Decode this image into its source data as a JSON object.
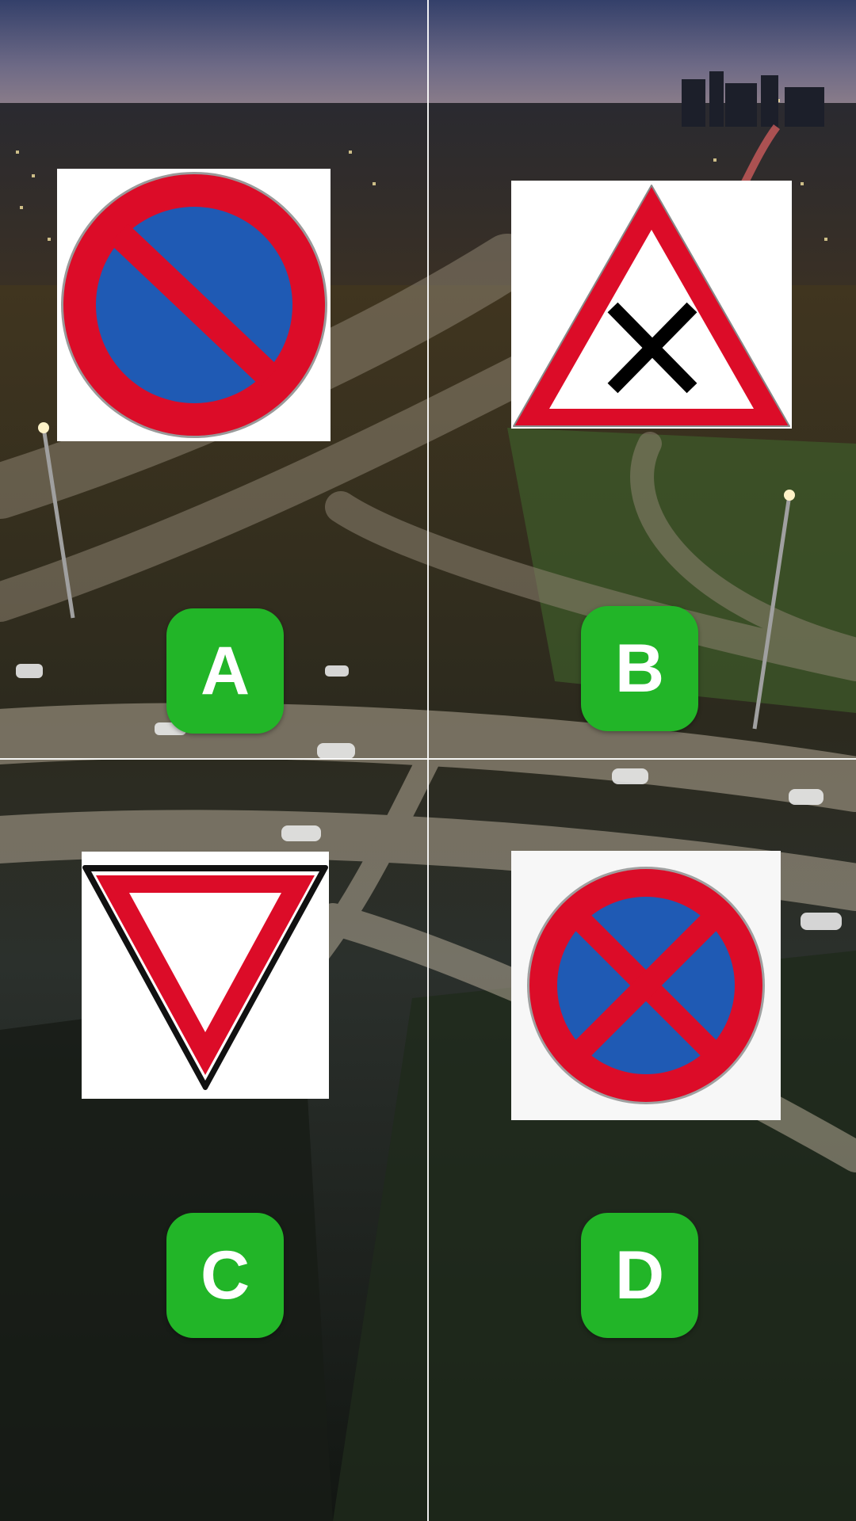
{
  "theme": {
    "button_color": "#22b528",
    "sign_red": "#dc0c28",
    "sign_blue": "#1f5ab4",
    "sky_top": "#3b4a78",
    "ground_dark": "#141a14"
  },
  "options": [
    {
      "label": "A",
      "sign": "no-parking-sign"
    },
    {
      "label": "B",
      "sign": "crossroads-priority-to-right-sign"
    },
    {
      "label": "C",
      "sign": "yield-sign"
    },
    {
      "label": "D",
      "sign": "no-stopping-sign"
    }
  ]
}
